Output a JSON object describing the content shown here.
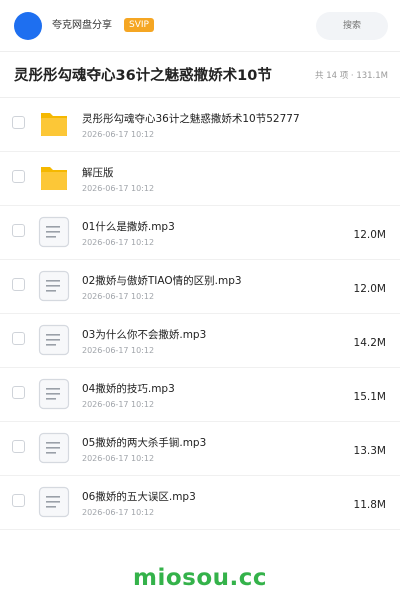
{
  "header": {
    "share_name": "夸克网盘分享",
    "badge": "SVIP",
    "search_placeholder": "搜索"
  },
  "folder": {
    "title": "灵彤彤勾魂夺心36计之魅惑撒娇术10节",
    "meta": "共 14 项 · 131.1M"
  },
  "items": [
    {
      "type": "folder",
      "name": "灵彤彤勾魂夺心36计之魅惑撒娇术10节52777",
      "date": "2026-06-17 10:12",
      "size": ""
    },
    {
      "type": "folder",
      "name": "解压版",
      "date": "2026-06-17 10:12",
      "size": ""
    },
    {
      "type": "file",
      "name": "01什么是撒娇.mp3",
      "date": "2026-06-17 10:12",
      "size": "12.0M"
    },
    {
      "type": "file",
      "name": "02撒娇与傲娇TIAO情的区别.mp3",
      "date": "2026-06-17 10:12",
      "size": "12.0M"
    },
    {
      "type": "file",
      "name": "03为什么你不会撒娇.mp3",
      "date": "2026-06-17 10:12",
      "size": "14.2M"
    },
    {
      "type": "file",
      "name": "04撒娇的技巧.mp3",
      "date": "2026-06-17 10:12",
      "size": "15.1M"
    },
    {
      "type": "file",
      "name": "05撒娇的两大杀手锏.mp3",
      "date": "2026-06-17 10:12",
      "size": "13.3M"
    },
    {
      "type": "file",
      "name": "06撒娇的五大误区.mp3",
      "date": "2026-06-17 10:12",
      "size": "11.8M"
    }
  ],
  "watermark": "miosou.cc",
  "colors": {
    "avatar": "#1e6ff0",
    "badge": "#f5a623",
    "folder": "#fcc737",
    "watermark": "#34b24a"
  }
}
